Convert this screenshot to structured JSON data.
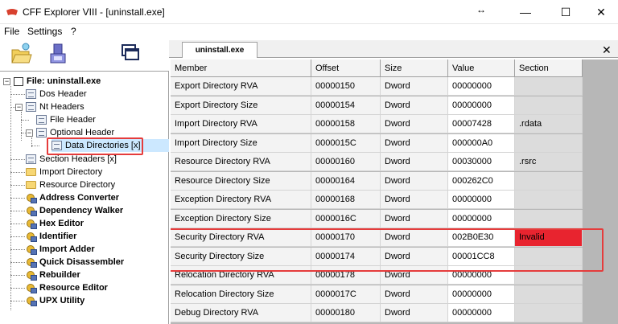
{
  "window": {
    "title": "CFF Explorer VIII - [uninstall.exe]",
    "resize_glyph": "↔",
    "minimize_glyph": "—",
    "maximize_glyph": "☐",
    "close_glyph": "✕"
  },
  "menu": [
    "File",
    "Settings",
    "?"
  ],
  "toolbar": {
    "icons": [
      "open-file-icon",
      "save-file-icon",
      "windows-icon"
    ]
  },
  "tree": {
    "root": "File: uninstall.exe",
    "dos_header": "Dos Header",
    "nt_headers": "Nt Headers",
    "file_header": "File Header",
    "optional_header": "Optional Header",
    "data_directories": "Data Directories [x]",
    "section_headers": "Section Headers [x]",
    "import_directory": "Import Directory",
    "resource_directory": "Resource Directory",
    "tools": [
      "Address Converter",
      "Dependency Walker",
      "Hex Editor",
      "Identifier",
      "Import Adder",
      "Quick Disassembler",
      "Rebuilder",
      "Resource Editor",
      "UPX Utility"
    ]
  },
  "tabs": {
    "active": "uninstall.exe",
    "close_glyph": "✕"
  },
  "grid": {
    "headers": [
      "Member",
      "Offset",
      "Size",
      "Value",
      "Section"
    ],
    "rows": [
      [
        "Export Directory RVA",
        "00000150",
        "Dword",
        "00000000",
        ""
      ],
      [
        "Export Directory Size",
        "00000154",
        "Dword",
        "00000000",
        ""
      ],
      [
        "Import Directory RVA",
        "00000158",
        "Dword",
        "00007428",
        ".rdata"
      ],
      [
        "Import Directory Size",
        "0000015C",
        "Dword",
        "000000A0",
        ""
      ],
      [
        "Resource Directory RVA",
        "00000160",
        "Dword",
        "00030000",
        ".rsrc"
      ],
      [
        "Resource Directory Size",
        "00000164",
        "Dword",
        "000262C0",
        ""
      ],
      [
        "Exception Directory RVA",
        "00000168",
        "Dword",
        "00000000",
        ""
      ],
      [
        "Exception Directory Size",
        "0000016C",
        "Dword",
        "00000000",
        ""
      ],
      [
        "Security Directory RVA",
        "00000170",
        "Dword",
        "002B0E30",
        "Invalid"
      ],
      [
        "Security Directory Size",
        "00000174",
        "Dword",
        "00001CC8",
        ""
      ],
      [
        "Relocation Directory RVA",
        "00000178",
        "Dword",
        "00000000",
        ""
      ],
      [
        "Relocation Directory Size",
        "0000017C",
        "Dword",
        "00000000",
        ""
      ],
      [
        "Debug Directory RVA",
        "00000180",
        "Dword",
        "00000000",
        ""
      ]
    ]
  },
  "colors": {
    "invalid": "#e8242f",
    "callout": "#e53c3c",
    "selection": "#cce8ff"
  }
}
